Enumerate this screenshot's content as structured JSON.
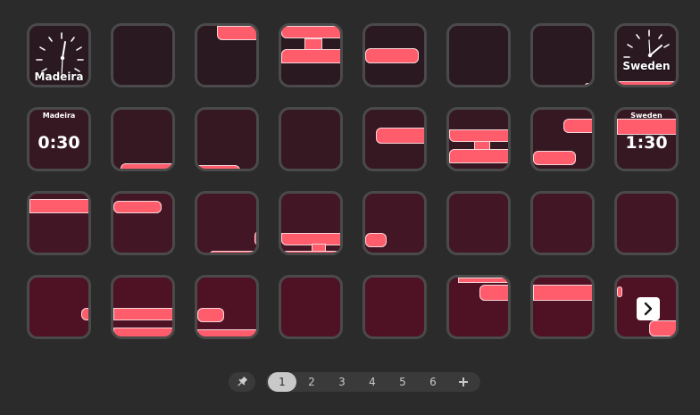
{
  "colors": {
    "background": "#2b2b2b",
    "tile_border": "#4a4a4a",
    "tile_row1": "#2a1921",
    "tile_row2": "#361822",
    "tile_row3": "#421624",
    "tile_row4": "#4e1224",
    "accent": "#ff5c6c",
    "pager_bg": "#3a3a3a",
    "active_page": "#c9c9c9"
  },
  "clocks": {
    "madeira_analog_label": "Madeira",
    "sweden_analog_label": "Sweden",
    "madeira_digital_label": "Madeira",
    "madeira_digital_time": "0:30",
    "sweden_digital_label": "Sweden",
    "sweden_digital_time": "1:30"
  },
  "pager": {
    "pin_icon": "pin-icon",
    "pages": [
      "1",
      "2",
      "3",
      "4",
      "5",
      "6"
    ],
    "active_page": "1",
    "add_icon": "plus-icon"
  },
  "next_button_icon": "chevron-right-icon"
}
